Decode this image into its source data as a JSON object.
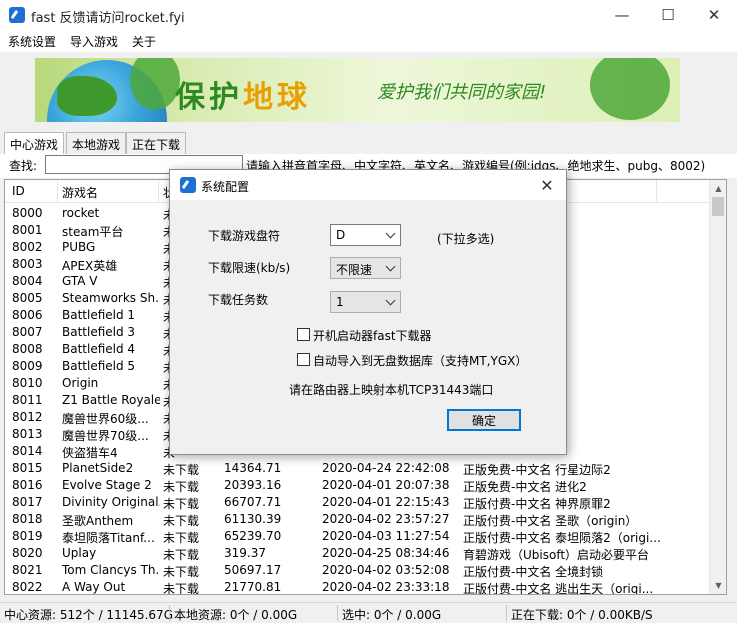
{
  "window": {
    "title": "fast 反馈请访问rocket.fyi",
    "minimize_glyph": "—",
    "maximize_glyph": "☐",
    "close_glyph": "✕"
  },
  "menu": [
    "系统设置",
    "导入游戏",
    "关于"
  ],
  "banner": {
    "headline_a": "保护",
    "headline_b": "地球",
    "subtitle": "爱护我们共同的家园!"
  },
  "tabs": [
    "中心游戏",
    "本地游戏",
    "正在下载"
  ],
  "search": {
    "label": "查找:",
    "value": "",
    "hint": "请输入拼音首字母、中文字符、英文名、游戏编号(例:jdqs、绝地求生、pubg、8002)"
  },
  "table": {
    "headers": [
      "ID",
      "游戏名",
      "状",
      "",
      "",
      ""
    ],
    "rows": [
      {
        "id": "8000",
        "name": "rocket",
        "status": "未",
        "size": "",
        "date": "",
        "desc": ""
      },
      {
        "id": "8001",
        "name": "steam平台",
        "status": "未",
        "size": "",
        "date": "",
        "desc": "戏必备平台（..."
      },
      {
        "id": "8002",
        "name": "PUBG",
        "status": "未",
        "size": "",
        "date": "",
        "desc": "地求生大逃杀"
      },
      {
        "id": "8003",
        "name": "APEX英雄",
        "status": "未",
        "size": "",
        "date": "",
        "desc": "（origin）"
      },
      {
        "id": "8004",
        "name": "GTA V",
        "status": "未",
        "size": "",
        "date": "",
        "desc": "盗猎车5"
      },
      {
        "id": "8005",
        "name": "Steamworks Sh...",
        "status": "未",
        "size": "",
        "date": "",
        "desc": "（必要）"
      },
      {
        "id": "8006",
        "name": "Battlefield 1",
        "status": "未",
        "size": "",
        "date": "",
        "desc": "地1（origin）"
      },
      {
        "id": "8007",
        "name": "Battlefield 3",
        "status": "未",
        "size": "",
        "date": "",
        "desc": "地3（origin）"
      },
      {
        "id": "8008",
        "name": "Battlefield 4",
        "status": "未",
        "size": "",
        "date": "",
        "desc": "地4（origin）"
      },
      {
        "id": "8009",
        "name": "Battlefield 5",
        "status": "未",
        "size": "",
        "date": "",
        "desc": "地5（origin）"
      },
      {
        "id": "8010",
        "name": "Origin",
        "status": "未",
        "size": "",
        "date": "",
        "desc": ""
      },
      {
        "id": "8011",
        "name": "Z1 Battle Royale",
        "status": "未",
        "size": "",
        "date": "",
        "desc": "戮之王(H1Z1)"
      },
      {
        "id": "8012",
        "name": "魔兽世界60级...",
        "status": "未",
        "size": "",
        "date": "",
        "desc": ""
      },
      {
        "id": "8013",
        "name": "魔兽世界70级...",
        "status": "未",
        "size": "",
        "date": "",
        "desc": ""
      },
      {
        "id": "8014",
        "name": "侠盗猎车4",
        "status": "未",
        "size": "",
        "date": "",
        "desc": ""
      },
      {
        "id": "8015",
        "name": "PlanetSide2",
        "status": "未下载",
        "size": "14364.71",
        "date": "2020-04-24 22:42:08",
        "desc": "正版免费-中文名 行星边际2"
      },
      {
        "id": "8016",
        "name": "Evolve Stage 2",
        "status": "未下载",
        "size": "20393.16",
        "date": "2020-04-01 20:07:38",
        "desc": "正版免费-中文名 进化2"
      },
      {
        "id": "8017",
        "name": "Divinity Original...",
        "status": "未下载",
        "size": "66707.71",
        "date": "2020-04-01 22:15:43",
        "desc": "正版付费-中文名 神界原罪2"
      },
      {
        "id": "8018",
        "name": "圣歌Anthem",
        "status": "未下载",
        "size": "61130.39",
        "date": "2020-04-02 23:57:27",
        "desc": "正版付费-中文名 圣歌（origin）"
      },
      {
        "id": "8019",
        "name": "泰坦陨落Titanf...",
        "status": "未下载",
        "size": "65239.70",
        "date": "2020-04-03 11:27:54",
        "desc": "正版付费-中文名 泰坦陨落2（origi..."
      },
      {
        "id": "8020",
        "name": "Uplay",
        "status": "未下载",
        "size": "319.37",
        "date": "2020-04-25 08:34:46",
        "desc": "育碧游戏（Ubisoft）启动必要平台"
      },
      {
        "id": "8021",
        "name": "Tom Clancys Th...",
        "status": "未下载",
        "size": "50697.17",
        "date": "2020-04-02 03:52:08",
        "desc": "正版付费-中文名 全境封锁"
      },
      {
        "id": "8022",
        "name": "A Way Out",
        "status": "未下载",
        "size": "21770.81",
        "date": "2020-04-02 23:33:18",
        "desc": "正版付费-中文名 逃出生天（origi..."
      }
    ]
  },
  "statusbar": {
    "center": "中心资源: 512个 / 11145.67G",
    "local": "本地资源: 0个 / 0.00G",
    "selected": "选中: 0个 / 0.00G",
    "downloading": "正在下载: 0个 / 0.00KB/S"
  },
  "dialog": {
    "title": "系统配置",
    "close_glyph": "✕",
    "drive_label": "下载游戏盘符",
    "drive_value": "D",
    "drive_hint": "(下拉多选)",
    "speed_label": "下载限速(kb/s)",
    "speed_value": "不限速",
    "tasks_label": "下载任务数",
    "tasks_value": "1",
    "autostart_label": "开机启动器fast下载器",
    "autostart_checked": false,
    "autoimport_label": "自动导入到无盘数据库（支持MT,YGX）",
    "autoimport_checked": false,
    "port_note": "请在路由器上映射本机TCP31443端口",
    "ok_label": "确定"
  },
  "colors": {
    "accent": "#0078d7",
    "banner_green": "#2d8a22",
    "banner_orange": "#e8a000",
    "icon_blue": "#1d6fd1"
  }
}
